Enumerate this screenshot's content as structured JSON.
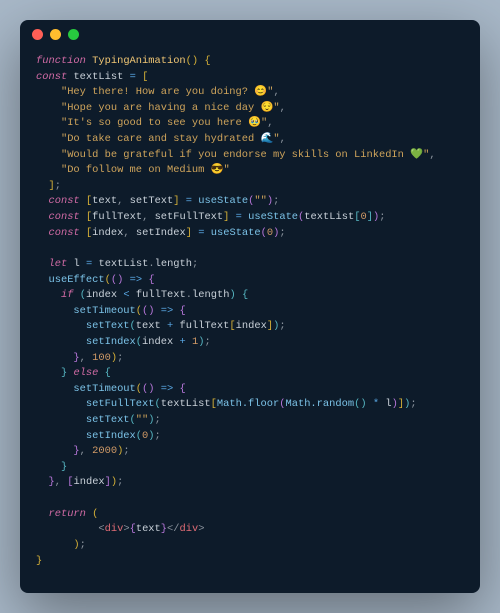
{
  "titlebar": {
    "buttons": [
      "close",
      "minimize",
      "zoom"
    ]
  },
  "code": {
    "fn_kw": "function",
    "fn_name": "TypingAnimation",
    "const_kw": "const",
    "let_kw": "let",
    "if_kw": "if",
    "else_kw": "else",
    "return_kw": "return",
    "textList_name": "textList",
    "strings": {
      "s0": "\"Hey there! How are you doing? 😊\"",
      "s1": "\"Hope you are having a nice day 😌\"",
      "s2": "\"It's so good to see you here 🥹\"",
      "s3": "\"Do take care and stay hydrated 🌊\"",
      "s4": "\"Would be grateful if you endorse my skills on LinkedIn 💚\"",
      "s5": "\"Do follow me on Medium 😎\""
    },
    "text_var": "text",
    "setText_var": "setText",
    "fullText_var": "fullText",
    "setFullText_var": "setFullText",
    "index_var": "index",
    "setIndex_var": "setIndex",
    "useState": "useState",
    "useEffect": "useEffect",
    "setTimeout": "setTimeout",
    "empty_str": "\"\"",
    "zero": "0",
    "one": "1",
    "hundred": "100",
    "twothousand": "2000",
    "l_var": "l",
    "length_prop": "length",
    "Math_floor": "Math.floor",
    "Math_random": "Math.random",
    "div_tag": "div",
    "arrow": "=>"
  }
}
